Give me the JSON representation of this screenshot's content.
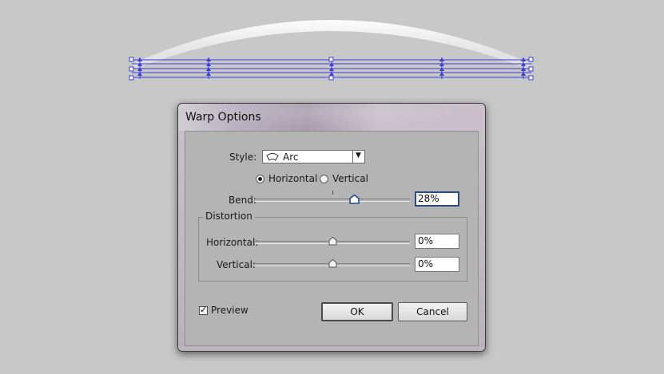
{
  "dialog": {
    "title": "Warp Options",
    "style_label": "Style:",
    "style_value": "Arc",
    "style_icon": "arc-warp-icon",
    "orientation": {
      "horizontal_label": "Horizontal",
      "vertical_label": "Vertical",
      "selected": "Horizontal"
    },
    "bend": {
      "label": "Bend:",
      "value": "28%",
      "level_percent": 28
    },
    "distortion": {
      "title": "Distortion",
      "horizontal": {
        "label": "Horizontal:",
        "value": "0%",
        "level_percent": 0
      },
      "vertical": {
        "label": "Vertical:",
        "value": "0%",
        "level_percent": 0
      }
    },
    "preview": {
      "label": "Preview",
      "checked": true
    },
    "buttons": {
      "ok": "OK",
      "cancel": "Cancel"
    }
  },
  "colors": {
    "canvas": "#c8c8c8",
    "selection_path": "#3d3dd8",
    "dialog_body": "#b4b4b4",
    "focus_border": "#2a4a8a"
  }
}
